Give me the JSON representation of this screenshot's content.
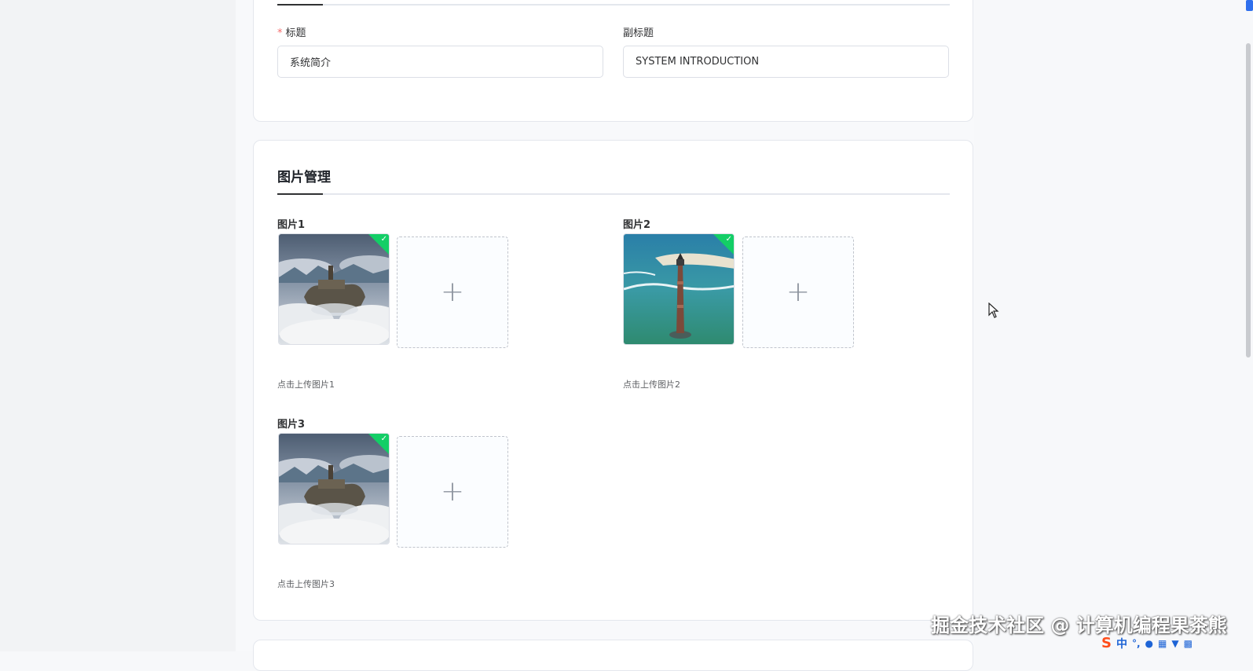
{
  "basic_info": {
    "title_label": "标题",
    "title_required_mark": "*",
    "title_value": "系统简介",
    "subtitle_label": "副标题",
    "subtitle_value": "SYSTEM INTRODUCTION"
  },
  "image_section": {
    "title": "图片管理",
    "items": [
      {
        "label": "图片1",
        "hint": "点击上传图片1",
        "uploaded": true,
        "image": "castle-in-clouds"
      },
      {
        "label": "图片2",
        "hint": "点击上传图片2",
        "uploaded": true,
        "image": "lighthouse-at-sea"
      },
      {
        "label": "图片3",
        "hint": "点击上传图片3",
        "uploaded": true,
        "image": "castle-in-clouds"
      }
    ]
  },
  "colors": {
    "success_badge": "#13ce66",
    "required_mark": "#f56c6c",
    "accent_underline": "#303133"
  },
  "overlay": {
    "watermark": "掘金技术社区 @ 计算机编程果茶熊",
    "ime_s": "S",
    "ime_lang": "中",
    "ime_icons": [
      "punctuation-icon",
      "microphone-icon",
      "keyboard-icon",
      "skin-icon",
      "toolbox-icon"
    ]
  },
  "icons": {
    "upload_plus": "+",
    "check": "✓"
  }
}
